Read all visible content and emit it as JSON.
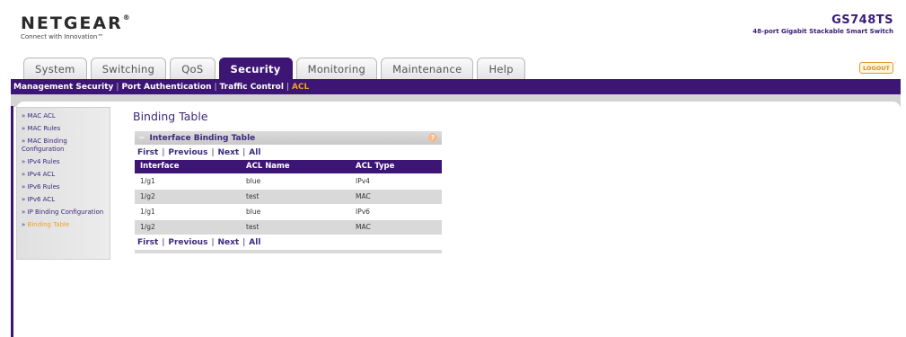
{
  "header": {
    "logo": "NETGEAR",
    "logo_mark": "®",
    "tagline": "Connect with Innovation™",
    "model": "GS748TS",
    "model_desc": "48-port Gigabit Stackable Smart Switch"
  },
  "tabs": [
    {
      "label": "System"
    },
    {
      "label": "Switching"
    },
    {
      "label": "QoS"
    },
    {
      "label": "Security"
    },
    {
      "label": "Monitoring"
    },
    {
      "label": "Maintenance"
    },
    {
      "label": "Help"
    }
  ],
  "active_tab": "Security",
  "logout_label": "LOGOUT",
  "subnav": {
    "items": [
      "Management Security",
      "Port Authentication",
      "Traffic Control",
      "ACL"
    ],
    "active": "ACL"
  },
  "sidemenu": {
    "items": [
      {
        "label": "MAC ACL"
      },
      {
        "label": "MAC Rules"
      },
      {
        "label": "MAC Binding Configuration"
      },
      {
        "label": "IPv4 Rules"
      },
      {
        "label": "IPv4 ACL"
      },
      {
        "label": "IPv6 Rules"
      },
      {
        "label": "IPv6 ACL"
      },
      {
        "label": "IP Binding Configuration"
      },
      {
        "label": "Binding Table"
      }
    ],
    "active": "Binding Table",
    "arrow": "»"
  },
  "main": {
    "title": "Binding Table",
    "panel_title": "Interface Binding Table",
    "panel_collapse": "−",
    "help": "?",
    "pager": {
      "first": "First",
      "previous": "Previous",
      "next": "Next",
      "all": "All",
      "sep": "|"
    },
    "columns": [
      "Interface",
      "ACL Name",
      "ACL Type"
    ],
    "rows": [
      [
        "1/g1",
        "blue",
        "IPv4"
      ],
      [
        "1/g2",
        "test",
        "MAC"
      ],
      [
        "1/g1",
        "blue",
        "IPv6"
      ],
      [
        "1/g2",
        "test",
        "MAC"
      ]
    ]
  },
  "colors": {
    "brand_purple": "#3d1574",
    "active_orange": "#f0a020"
  }
}
